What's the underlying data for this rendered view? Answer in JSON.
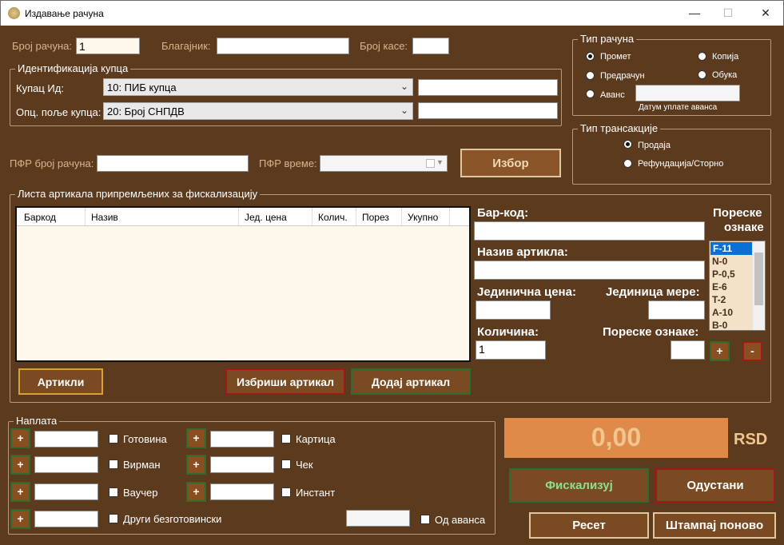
{
  "window": {
    "title": "Издавање рачуна",
    "minimize": "—",
    "maximize": "☐",
    "close": "✕"
  },
  "header": {
    "invoice_no_label": "Број рачуна:",
    "invoice_no_value": "1",
    "cashier_label": "Благајник:",
    "cashier_value": "",
    "register_label": "Број касе:",
    "register_value": ""
  },
  "buyer": {
    "legend": "Идентификација купца",
    "id_label": "Купац Ид:",
    "id_select": "10: ПИБ купца",
    "id_value": "",
    "opt_label": "Опц. поље купца:",
    "opt_select": "20: Број СНПДВ",
    "opt_value": ""
  },
  "invoice_type": {
    "legend": "Тип рачуна",
    "options": [
      "Промет",
      "Предрачун",
      "Аванс",
      "Копија",
      "Обука"
    ],
    "selected": "Промет",
    "advance_date_label": "Датум уплате аванса",
    "advance_date_value": ""
  },
  "transaction_type": {
    "legend": "Тип трансакције",
    "options": [
      "Продаја",
      "Рефундација/Сторно"
    ],
    "selected": "Продаја"
  },
  "pfr": {
    "number_label": "ПФР број рачуна:",
    "number_value": "",
    "time_label": "ПФР време:",
    "time_value": "",
    "choose_button": "Избор"
  },
  "items": {
    "legend": "Листа артикала припремљених за фискализацију",
    "columns": [
      "Баркод",
      "Назив",
      "Јед. цена",
      "Колич.",
      "Порез",
      "Укупно"
    ],
    "articles_button": "Артикли",
    "delete_button": "Избриши артикал",
    "add_button": "Додај артикал"
  },
  "article_form": {
    "barcode_label": "Бар-код:",
    "barcode_value": "",
    "name_label": "Назив артикла:",
    "name_value": "",
    "unit_price_label": "Јединична цена:",
    "unit_price_value": "",
    "unit_label": "Јединица мере:",
    "unit_value": "",
    "qty_label": "Количина:",
    "qty_value": "1",
    "tax_labels_label": "Пореске ознаке:",
    "tax_labels_value": "",
    "tax_list_title_1": "Пореске",
    "tax_list_title_2": "ознаке",
    "tax_list": [
      "F-11",
      "N-0",
      "P-0,5",
      "E-6",
      "T-2",
      "A-10",
      "B-0"
    ],
    "tax_selected": "F-11",
    "plus": "+",
    "minus": "-"
  },
  "payment": {
    "legend": "Наплата",
    "plus": "+",
    "left_methods": [
      "Готовина",
      "Вирман",
      "Ваучер",
      "Други безготовински"
    ],
    "right_methods": [
      "Картица",
      "Чек",
      "Инстант"
    ],
    "from_advance": "Од аванса"
  },
  "totals": {
    "amount": "0,00",
    "currency": "RSD"
  },
  "actions": {
    "fiscalize": "Фискализуј",
    "cancel": "Одустани",
    "reset": "Ресет",
    "reprint": "Штампај поново"
  },
  "colors": {
    "background": "#5c3a1e",
    "button": "#7a4a22",
    "accent_green": "#2e6b2e",
    "accent_red": "#8b1a1a",
    "total_bg": "#e08a4a",
    "selection": "#0a6fd6"
  }
}
